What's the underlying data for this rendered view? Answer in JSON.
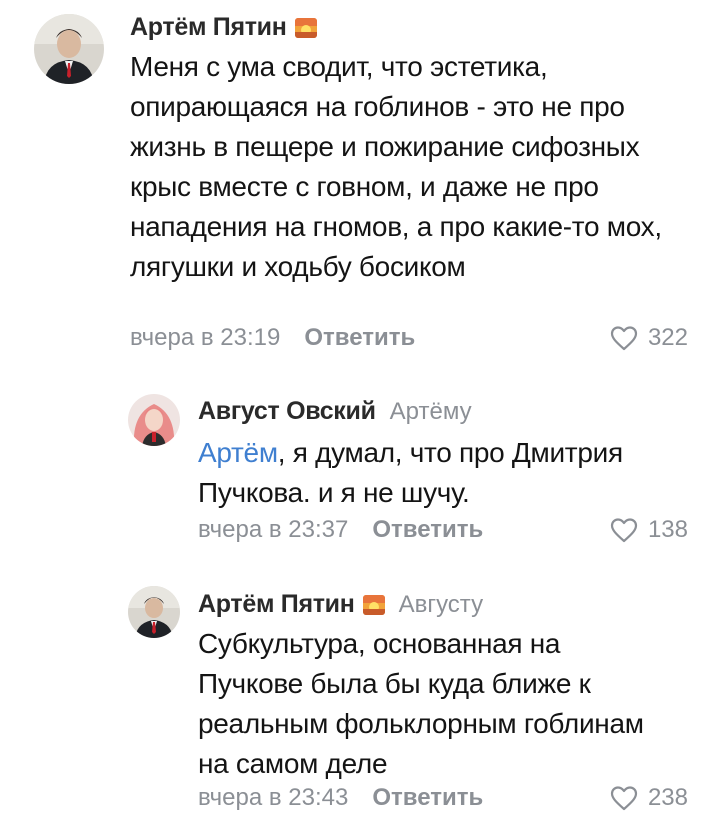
{
  "comments": [
    {
      "author": "Артём Пятин",
      "text": "Меня с ума сводит, что эстетика, опирающаяся на гоблинов - это не про жизнь в пещере и пожирание сифозных крыс вместе с говном, и даже не про нападения на гномов, а про какие-то мох, лягушки и ходьбу босиком",
      "time": "вчера в 23:19",
      "reply_label": "Ответить",
      "likes": "322"
    },
    {
      "author": "Август Овский",
      "reply_to": "Артёму",
      "mention": "Артём",
      "text": ", я думал, что про Дмитрия Пучкова. и я не шучу.",
      "time": "вчера в 23:37",
      "reply_label": "Ответить",
      "likes": "138"
    },
    {
      "author": "Артём Пятин",
      "reply_to": "Августу",
      "text": "Субкультура, основанная на Пучкове была бы куда ближе к реальным фольклорным гоблинам на самом деле",
      "time": "вчера в 23:43",
      "reply_label": "Ответить",
      "likes": "238"
    }
  ],
  "colors": {
    "meta_gray": "#8b8f95",
    "mention_blue": "#3f7fd0",
    "text": "#141414"
  },
  "icons": {
    "like": "heart-outline-icon",
    "status": "sunset-emoji-icon"
  }
}
